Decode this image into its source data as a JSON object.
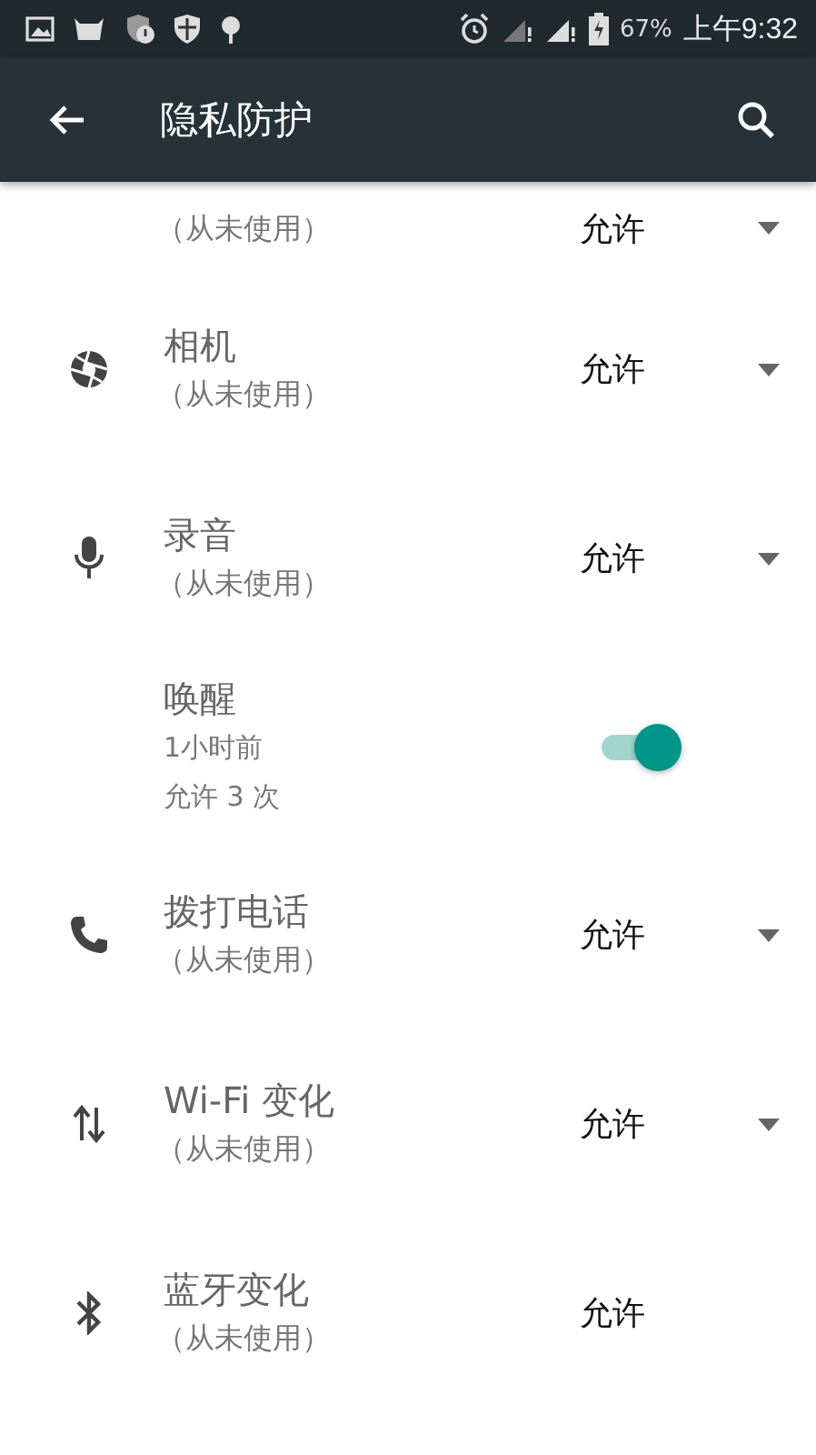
{
  "status_bar": {
    "battery": "67%",
    "time": "上午9:32"
  },
  "toolbar": {
    "title": "隐私防护"
  },
  "items": [
    {
      "kind": "select",
      "subtitle": "（从未使用）",
      "value": "允许",
      "caret": true
    },
    {
      "kind": "select",
      "title": "相机",
      "subtitle": "（从未使用）",
      "value": "允许",
      "caret": true
    },
    {
      "kind": "select",
      "title": "录音",
      "subtitle": "（从未使用）",
      "value": "允许",
      "caret": true
    },
    {
      "kind": "toggle",
      "title": "唤醒",
      "lines": [
        "1小时前",
        "允许 3 次"
      ],
      "on": true
    },
    {
      "kind": "select",
      "title": "拨打电话",
      "subtitle": "（从未使用）",
      "value": "允许",
      "caret": true
    },
    {
      "kind": "select",
      "title": "Wi-Fi 变化",
      "subtitle": "（从未使用）",
      "value": "允许",
      "caret": true
    },
    {
      "kind": "select",
      "title": "蓝牙变化",
      "subtitle": "（从未使用）",
      "value": "允许",
      "caret": false
    }
  ]
}
